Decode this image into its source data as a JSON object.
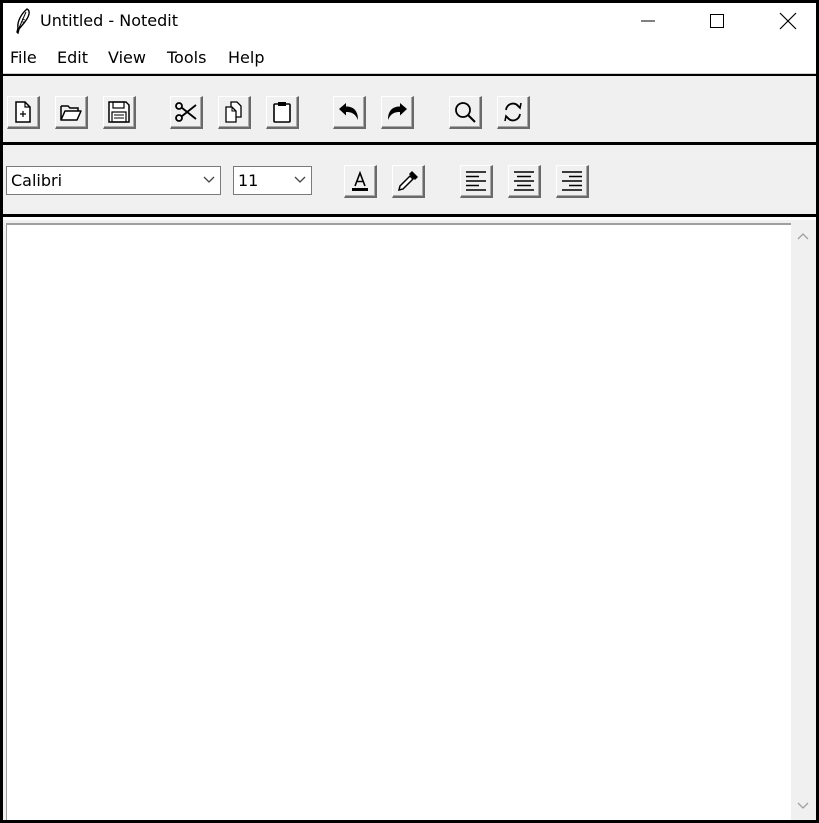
{
  "window": {
    "title": "Untitled - Notedit",
    "app_icon": "quill-icon",
    "controls": [
      "minimize-icon",
      "maximize-icon",
      "close-icon"
    ]
  },
  "menu": {
    "items": [
      {
        "label": "File"
      },
      {
        "label": "Edit"
      },
      {
        "label": "View"
      },
      {
        "label": "Tools"
      },
      {
        "label": "Help"
      }
    ]
  },
  "toolbar": {
    "buttons": [
      {
        "icon": "new-file-icon"
      },
      {
        "icon": "open-folder-icon"
      },
      {
        "icon": "save-disk-icon"
      },
      {
        "icon": "cut-scissors-icon"
      },
      {
        "icon": "copy-icon"
      },
      {
        "icon": "paste-clipboard-icon"
      },
      {
        "icon": "undo-icon"
      },
      {
        "icon": "redo-icon"
      },
      {
        "icon": "find-magnifier-icon"
      },
      {
        "icon": "replace-icon"
      }
    ]
  },
  "format_bar": {
    "font_family": "Calibri",
    "font_size": "11",
    "buttons": [
      {
        "icon": "font-color-icon"
      },
      {
        "icon": "color-picker-icon"
      },
      {
        "icon": "align-left-icon"
      },
      {
        "icon": "align-center-icon"
      },
      {
        "icon": "align-right-icon"
      }
    ]
  },
  "editor": {
    "content": ""
  },
  "colors": {
    "window_border": "#000000",
    "toolbar_bg": "#f0f0f0",
    "editor_bg": "#ffffff"
  }
}
